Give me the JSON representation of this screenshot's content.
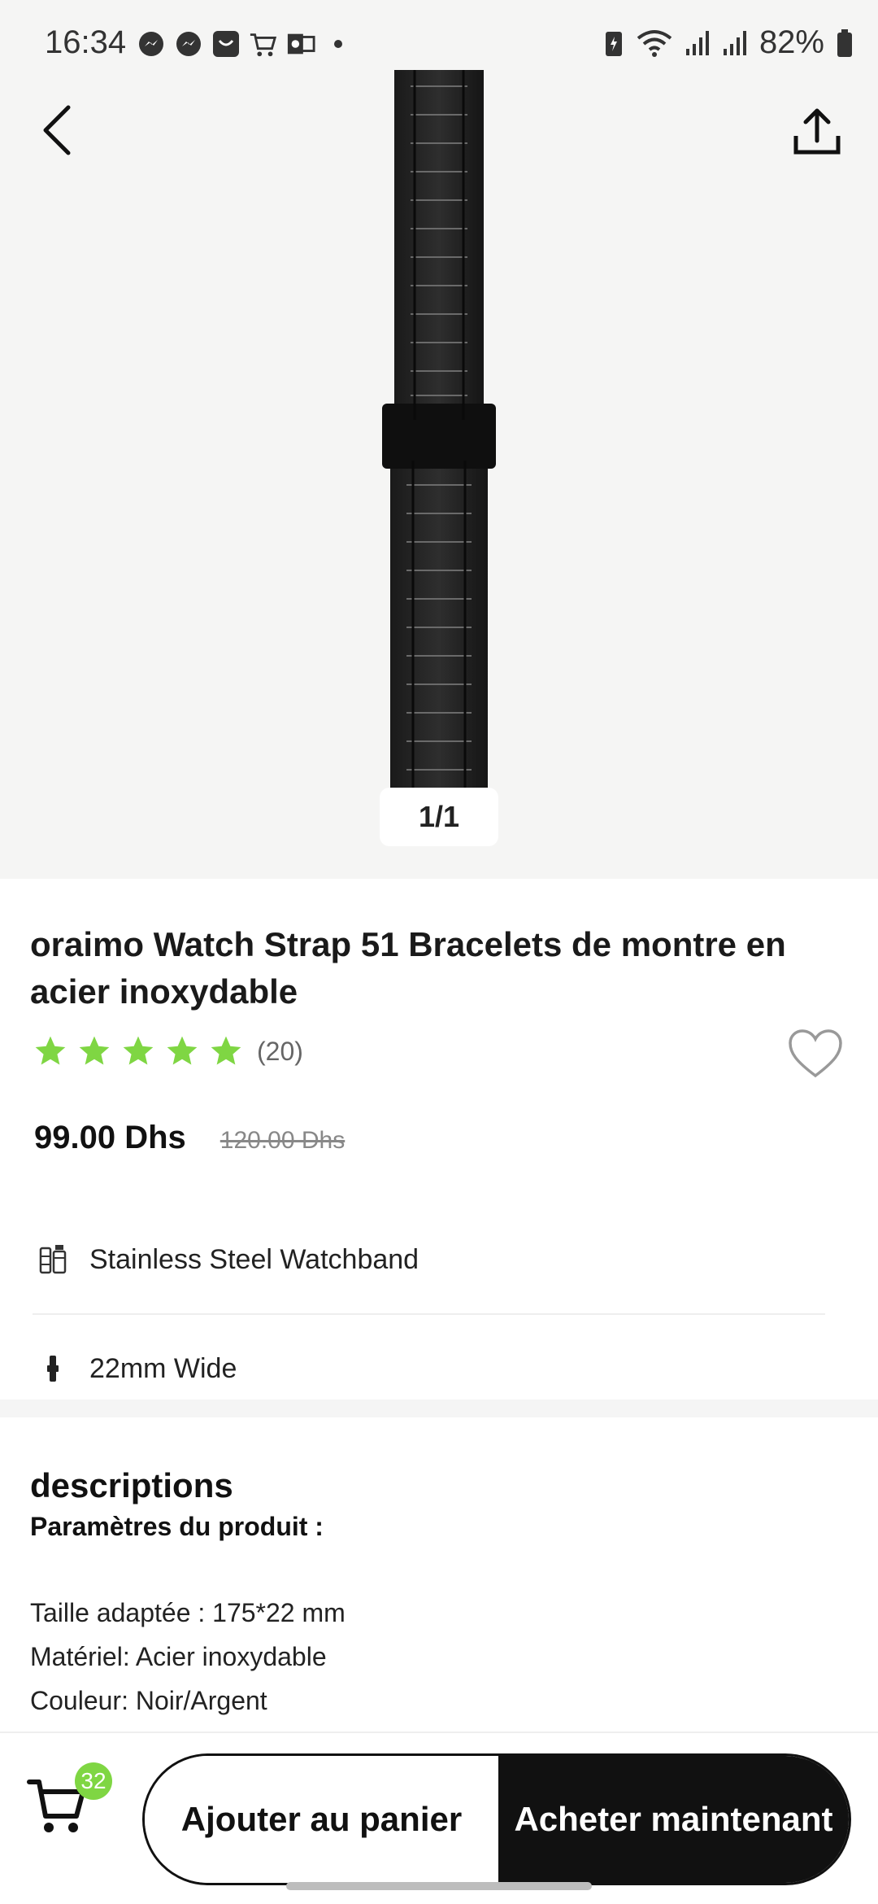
{
  "status_bar": {
    "time": "16:34",
    "battery_percent": "82%",
    "notification_icons": [
      "messenger-icon",
      "messenger-icon",
      "shop-icon",
      "cart-icon",
      "outlook-icon",
      "dot-icon"
    ]
  },
  "gallery": {
    "page_indicator": "1/1"
  },
  "product": {
    "title": "oraimo Watch Strap 51 Bracelets de montre en acier inoxydable",
    "rating_stars": 5,
    "rating_count": "(20)",
    "price": "99.00 Dhs",
    "old_price": "120.00 Dhs",
    "features": [
      {
        "icon": "watchband-icon",
        "text": "Stainless Steel Watchband"
      },
      {
        "icon": "strap-width-icon",
        "text": "22mm Wide"
      }
    ]
  },
  "description": {
    "heading": "descriptions",
    "subheading": "Paramètres du produit :",
    "lines": [
      "Taille adaptée : 175*22 mm",
      "Matériel: Acier inoxydable",
      "Couleur: Noir/Argent"
    ]
  },
  "bottom_bar": {
    "cart_count": "32",
    "add_to_cart_label": "Ajouter au panier",
    "buy_now_label": "Acheter maintenant"
  },
  "colors": {
    "star_green": "#7fd643",
    "badge_green": "#7fd643",
    "primary_black": "#111111",
    "hero_background": "#f5f5f4"
  }
}
